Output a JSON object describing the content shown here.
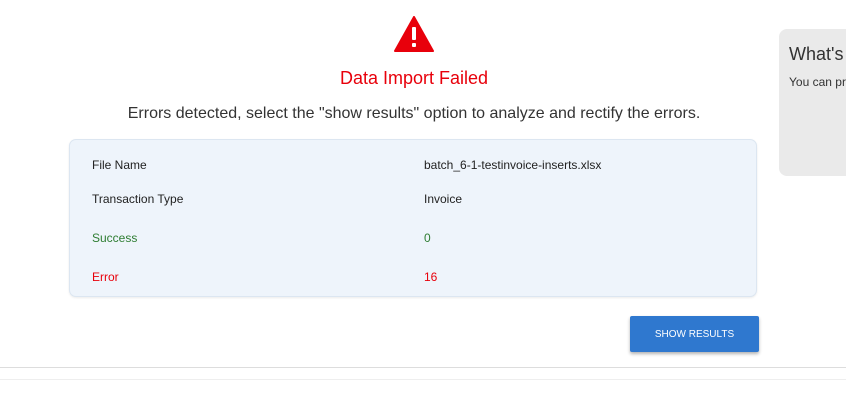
{
  "status": {
    "title": "Data Import Failed",
    "message": "Errors detected, select the \"show results\" option to analyze and rectify the errors."
  },
  "details": {
    "file_name": {
      "label": "File Name",
      "value": "batch_6-1-testinvoice-inserts.xlsx"
    },
    "transaction_type": {
      "label": "Transaction Type",
      "value": "Invoice"
    },
    "success": {
      "label": "Success",
      "value": "0"
    },
    "error": {
      "label": "Error",
      "value": "16"
    }
  },
  "actions": {
    "show_results_label": "SHOW RESULTS"
  },
  "side_panel": {
    "title": "What's",
    "text": "You can pr"
  },
  "colors": {
    "error_red": "#e8000b",
    "success_green": "#2e7d32",
    "primary_blue": "#2f78cf",
    "card_background": "#eef4fb"
  },
  "icons": {
    "status": "warning-triangle-icon"
  }
}
